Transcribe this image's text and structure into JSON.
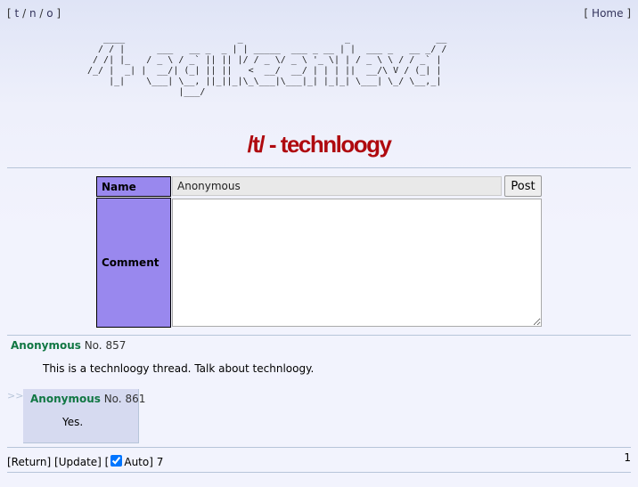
{
  "nav": {
    "open": "[",
    "boards": [
      "t",
      "n",
      "o"
    ],
    "sep": "/",
    "close": "]",
    "home_label": "Home"
  },
  "logo": {
    "ascii": "   ____                     _                   _                __ \n  / / |      ___   __ _  _ | | _____  ___ _ __ | |  ___ _   __ _/ / \n / /| |_   / _ \\ / _` || || |/ / _ \\/ _ \\ '_ \\| | / _ \\ \\ / / _` |  \n/_/ |  _| |  __/| (_| || ||   <  __/  __/ | | | ||  __/\\ V / (_| |  \n    |_|    \\___| \\__, ||_||_|\\_\\___|\\___|_| |_|_| \\___| \\_/ \\__,_|  \n                 |___/                                              "
  },
  "board": {
    "tag": "/t/",
    "title": "technloogy"
  },
  "form": {
    "name_label": "Name",
    "name_value": "Anonymous",
    "post_button": "Post",
    "comment_label": "Comment"
  },
  "thread": {
    "op": {
      "name": "Anonymous",
      "no": "No. 857",
      "body": "This is a technloogy thread. Talk about technloogy."
    },
    "reply_marker": ">>",
    "replies": [
      {
        "name": "Anonymous",
        "no": "No. 861",
        "body": "Yes."
      }
    ]
  },
  "controls": {
    "return_label": "[Return]",
    "update_label": "[Update]",
    "open_bracket": "[",
    "auto_label": "Auto]",
    "auto_checked": true,
    "count": "7"
  },
  "pagination": {
    "page": "1"
  },
  "colors": {
    "label_bg": "#9988ee",
    "title": "#af0a0f",
    "name": "#117743",
    "reply_bg": "#d6daf0",
    "hr": "#b7c5d9"
  }
}
